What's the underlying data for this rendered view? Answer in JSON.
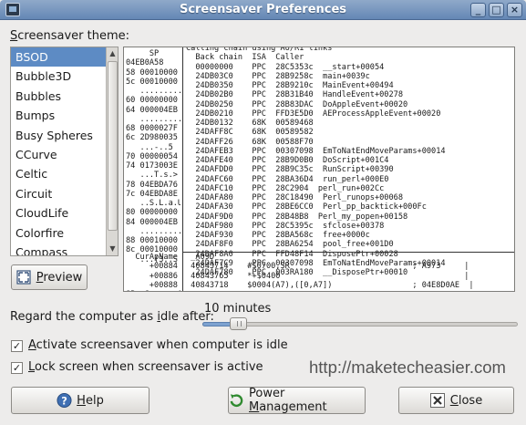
{
  "window": {
    "title": "Screensaver Preferences",
    "minimize": "_",
    "maximize": "□",
    "close": "×"
  },
  "theme": {
    "label_accel": "S",
    "label_rest": "creensaver theme:",
    "items": [
      "BSOD",
      "Bubble3D",
      "Bubbles",
      "Bumps",
      "Busy Spheres",
      "CCurve",
      "Celtic",
      "Circuit",
      "CloudLife",
      "Colorfire",
      "Compass"
    ],
    "selected": "BSOD",
    "scroll_up": "▲",
    "scroll_down": "▼"
  },
  "preview_screen": {
    "left_top": [
      "     SP",
      "04EB0A58",
      "58 00010000",
      "5c 00010000",
      "   .........",
      "60 00000000",
      "64 000004EB",
      "   .........",
      "68 0000027F",
      "6c 2D980035",
      "   ...-..5",
      "70 00000054",
      "74 0173003E",
      "   ...T.s.>",
      "78 04EBDA76",
      "7c 04EBDA8E",
      "   ..S.L.a.U",
      "80 00000000",
      "84 000004EB",
      "   .........",
      "88 00010000",
      "8c 00010000",
      "   ...(3..S"
    ],
    "left_bottom": [
      "  CurApName",
      "     +00884",
      "     +00886",
      "     +00888",
      "SP  Smxnzve0"
    ],
    "right_top": [
      "Calling chain using A6/R1 links",
      "  Back chain  ISA  Caller",
      "  00000000    PPC  28C5353c  __start+00054",
      "  24DB03C0    PPC  28B9258c  main+0039c",
      "  24DB0350    PPC  28B9210c  MainEvent+00494",
      "  24DB02B0    PPC  28B31B40  HandleEvent+00278",
      "  24DB0250    PPC  28B83DAC  DoAppleEvent+00020",
      "  24DB0210    PPC  FFD3E5D0  AEProcessAppleEvent+00020",
      "  24DB0132    68K  00589468",
      "  24DAFF8C    68K  00589582",
      "  24DAFF26    68K  00588F70",
      "  24DAFEB3    PPC  00307098  EmToNatEndMoveParams+00014",
      "  24DAFE40    PPC  28B9D0B0  DoScript+001C4",
      "  24DAFDD0    PPC  28B9C35c  RunScript+00390",
      "  24DAFC60    PPC  28BA36D4  run_perl+000E0",
      "  24DAFC10    PPC  28C2904  perl_run+002Cc",
      "  24DAFA80    PPC  28C18490  Perl_runops+00068",
      "  24DAFA30    PPC  28BE6CC0  Perl_pp_backtick+000Fc",
      "  24DAF9D0    PPC  28B48B8  Perl_my_popen+00158",
      "  24DAF980    PPC  28C5395c  sfclose+00378",
      "  24DAF930    PPC  28BA568c  free+0000c",
      "  24DAF8F0    PPC  28BA6254  pool_free+001D0",
      "  24DAF8A0    PPC  FFD48F14  DisposePtr+00028",
      "  24DAF7C9    PPC  00307098  EmToNatEndMoveParams+00014",
      "  24DAF780    PPC  003RA180  __DisposePtr+00010"
    ],
    "right_bottom": [
      " _A09D",
      " 40843714    #$0700,SR                          ; A973     |",
      " 40843765    *+$0400                                       |",
      " 40843718    $0004(A7),([0,A7])                 ; 04E8D0AE  |"
    ]
  },
  "preview_button": {
    "accel": "P",
    "rest": "review"
  },
  "idle": {
    "label_pre": "Regard the computer as ",
    "label_accel": "i",
    "label_post": "dle after:",
    "value_text": "10 minutes",
    "fraction": 0.093
  },
  "activate": {
    "checked": true,
    "accel": "A",
    "rest": "ctivate screensaver when computer is idle"
  },
  "lock": {
    "checked": true,
    "accel": "L",
    "rest": "ock screen when screensaver is active"
  },
  "watermark": "http://maketecheasier.com",
  "buttons": {
    "help_accel": "H",
    "help_rest": "elp",
    "power_pre": "Power ",
    "power_accel": "M",
    "power_rest": "anagement",
    "close_accel": "C",
    "close_rest": "lose"
  },
  "check_mark": "✓"
}
